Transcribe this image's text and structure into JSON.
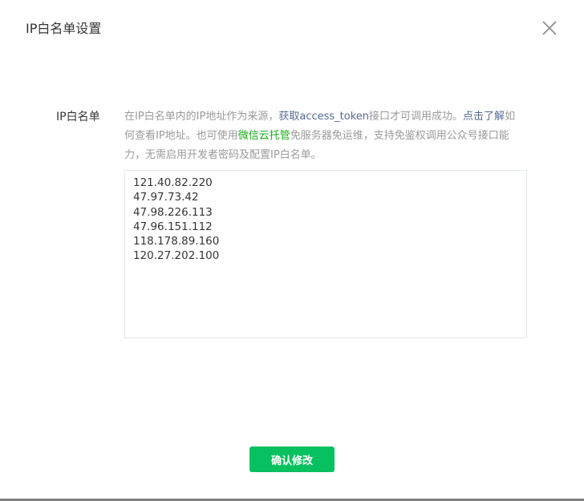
{
  "dialog": {
    "title": "IP白名单设置",
    "close_icon": "close-icon"
  },
  "form": {
    "label": "IP白名单",
    "desc": {
      "part1": "在IP白名单内的IP地址作为来源，",
      "link_token": "获取access_token",
      "part2": "接口才可调用成功。",
      "link_learn": "点击了解",
      "part3": "如何查看IP地址。也可使用",
      "link_cloud": "微信云托管",
      "part4": "免服务器免运维，支持免鉴权调用公众号接口能力，无需启用开发者密码及配置IP白名单。"
    },
    "ip_list": "121.40.82.220\n47.97.73.42\n47.98.226.113\n47.96.151.112\n118.178.89.160\n120.27.202.100"
  },
  "footer": {
    "confirm_label": "确认修改"
  },
  "colors": {
    "link_blue": "#576b95",
    "link_green": "#1aad19",
    "primary_button": "#07c160"
  }
}
